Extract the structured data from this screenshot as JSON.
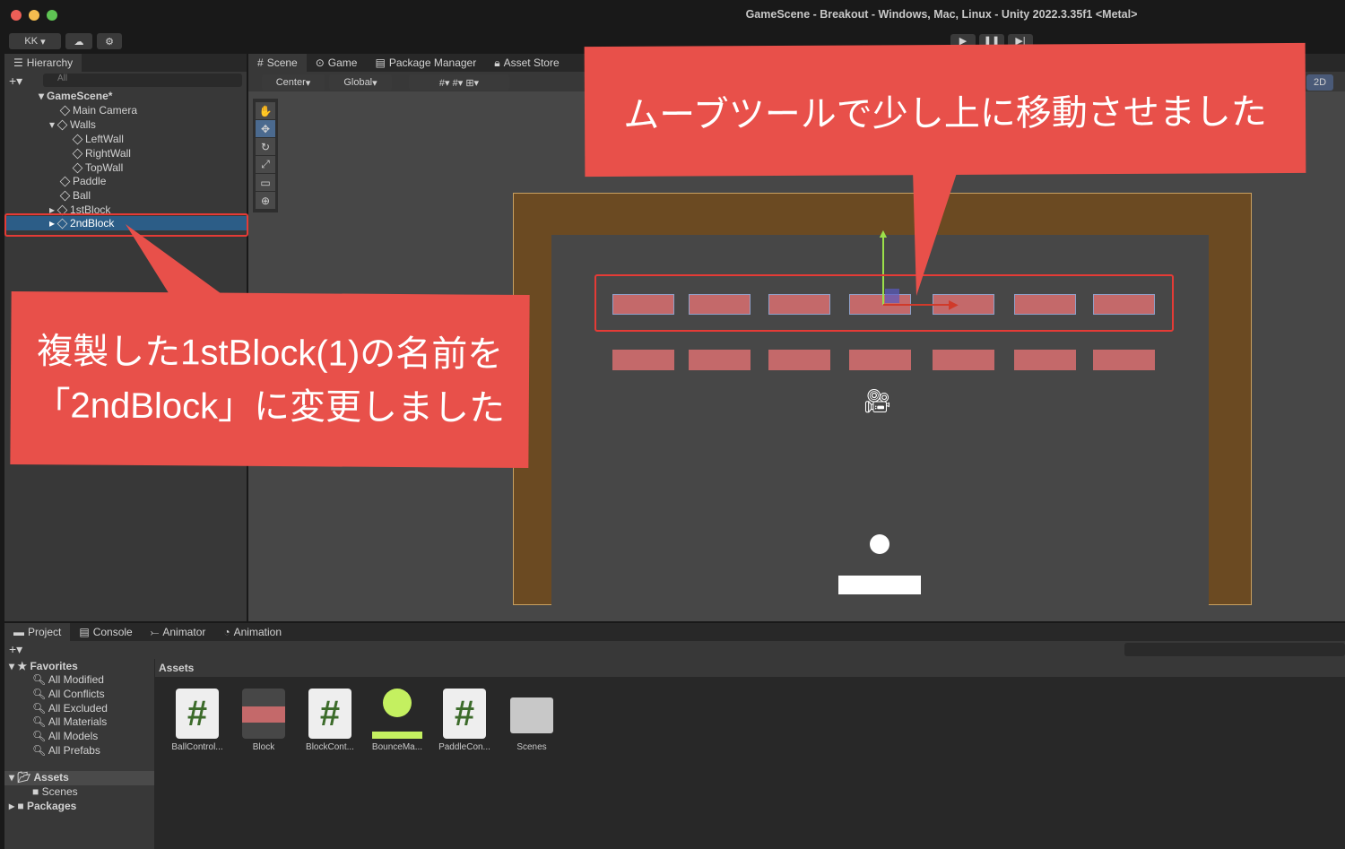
{
  "window": {
    "title": "GameScene - Breakout - Windows, Mac, Linux - Unity 2022.3.35f1 <Metal>"
  },
  "toolbar": {
    "account": "KK",
    "play_icon": "play-icon",
    "pause_icon": "pause-icon",
    "step_icon": "step-icon"
  },
  "hierarchy": {
    "tab": "Hierarchy",
    "search_placeholder": "All",
    "scene": "GameScene*",
    "items": [
      "Main Camera",
      "Walls",
      "LeftWall",
      "RightWall",
      "TopWall",
      "Paddle",
      "Ball",
      "1stBlock",
      "2ndBlock"
    ]
  },
  "scene_tabs": [
    "Scene",
    "Game",
    "Package Manager",
    "Asset Store"
  ],
  "scene_toolbar": {
    "pivot": "Center",
    "space": "Global",
    "mode_2d": "2D"
  },
  "bottom_tabs": [
    "Project",
    "Console",
    "Animator",
    "Animation"
  ],
  "project": {
    "favorites": "Favorites",
    "fav_items": [
      "All Modified",
      "All Conflicts",
      "All Excluded",
      "All Materials",
      "All Models",
      "All Prefabs"
    ],
    "assets_label": "Assets",
    "scenes": "Scenes",
    "packages": "Packages",
    "breadcrumb": "Assets",
    "assets": [
      "BallControl...",
      "Block",
      "BlockCont...",
      "BounceMa...",
      "PaddleCon...",
      "Scenes"
    ]
  },
  "callouts": {
    "top": "ムーブツールで少し上に移動させました",
    "left_line1": "複製した1stBlock(1)の名前を",
    "left_line2": "「2ndBlock」に変更しました"
  },
  "colors": {
    "callout": "#e8504a",
    "highlight": "#e53b36",
    "block": "#c4696a",
    "wall": "#6b4a22"
  }
}
